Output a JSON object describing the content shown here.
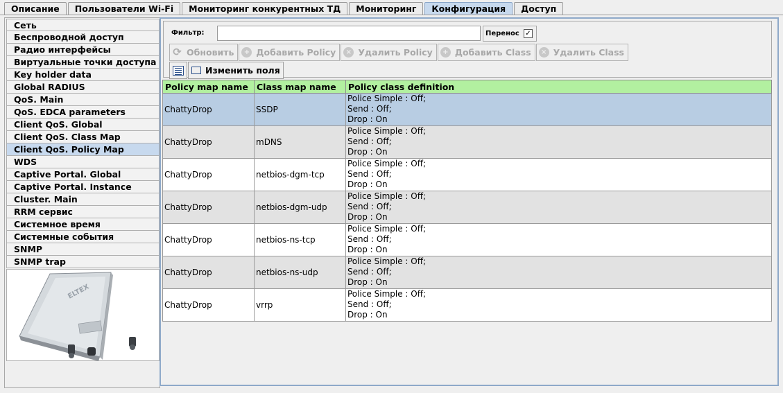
{
  "tabs": [
    {
      "label": "Описание"
    },
    {
      "label": "Пользователи Wi-Fi"
    },
    {
      "label": "Мониторинг конкурентных ТД"
    },
    {
      "label": "Мониторинг"
    },
    {
      "label": "Конфигурация",
      "active": true
    },
    {
      "label": "Доступ"
    }
  ],
  "sidebar": {
    "items": [
      {
        "label": "Сеть"
      },
      {
        "label": "Беспроводной доступ"
      },
      {
        "label": "Радио интерфейсы"
      },
      {
        "label": "Виртуальные точки доступа"
      },
      {
        "label": "Key holder data"
      },
      {
        "label": "Global RADIUS"
      },
      {
        "label": "QoS. Main"
      },
      {
        "label": "QoS. EDCA parameters"
      },
      {
        "label": "Client QoS. Global"
      },
      {
        "label": "Client QoS. Class Map"
      },
      {
        "label": "Client QoS. Policy Map",
        "selected": true
      },
      {
        "label": "WDS"
      },
      {
        "label": "Captive Portal. Global"
      },
      {
        "label": "Captive Portal. Instance"
      },
      {
        "label": "Cluster. Main"
      },
      {
        "label": "RRM сервис"
      },
      {
        "label": "Системное время"
      },
      {
        "label": "Системные события"
      },
      {
        "label": "SNMP"
      },
      {
        "label": "SNMP trap"
      }
    ],
    "device_logo": "ELTEX"
  },
  "toolbar": {
    "filter_label": "Фильтр:",
    "filter_value": "",
    "wrap_label": "Перенос",
    "wrap_checked": true,
    "refresh_label": "Обновить",
    "add_policy_label": "Добавить Policy",
    "delete_policy_label": "Удалить Policy",
    "add_class_label": "Добавить Class",
    "delete_class_label": "Удалить Class",
    "edit_fields_label": "Изменить поля"
  },
  "table": {
    "columns": [
      "Policy map name",
      "Class map name",
      "Policy class definition"
    ],
    "rows": [
      {
        "policy": "ChattyDrop",
        "class": "SSDP",
        "def": [
          "Police Simple : Off;",
          "Send : Off;",
          "Drop : On"
        ],
        "selected": true
      },
      {
        "policy": "ChattyDrop",
        "class": "mDNS",
        "def": [
          "Police Simple : Off;",
          "Send : Off;",
          "Drop : On"
        ]
      },
      {
        "policy": "ChattyDrop",
        "class": "netbios-dgm-tcp",
        "def": [
          "Police Simple : Off;",
          "Send : Off;",
          "Drop : On"
        ]
      },
      {
        "policy": "ChattyDrop",
        "class": "netbios-dgm-udp",
        "def": [
          "Police Simple : Off;",
          "Send : Off;",
          "Drop : On"
        ]
      },
      {
        "policy": "ChattyDrop",
        "class": "netbios-ns-tcp",
        "def": [
          "Police Simple : Off;",
          "Send : Off;",
          "Drop : On"
        ]
      },
      {
        "policy": "ChattyDrop",
        "class": "netbios-ns-udp",
        "def": [
          "Police Simple : Off;",
          "Send : Off;",
          "Drop : On"
        ]
      },
      {
        "policy": "ChattyDrop",
        "class": "vrrp",
        "def": [
          "Police Simple : Off;",
          "Send : Off;",
          "Drop : On"
        ]
      }
    ]
  },
  "icons": {
    "refresh": "refresh-icon",
    "disabled_action": "disabled-circle-icon",
    "columns": "column-list-icon",
    "edit_fields": "edit-fields-icon",
    "checkbox": "checkmark-icon"
  }
}
